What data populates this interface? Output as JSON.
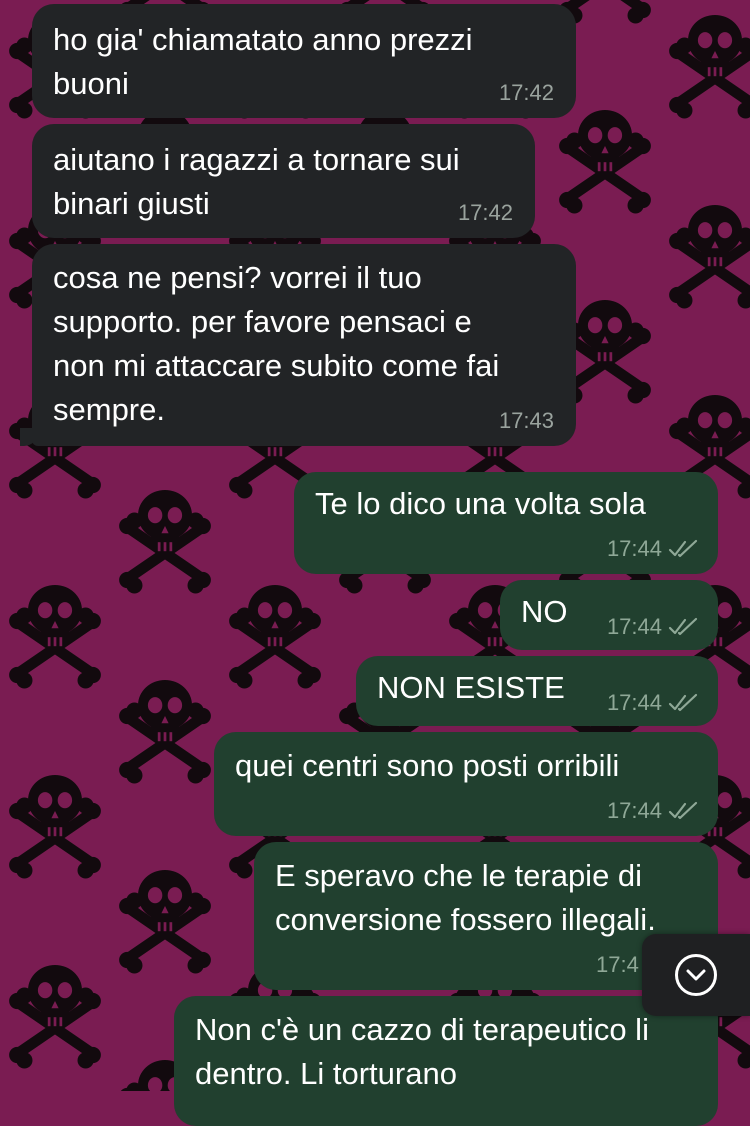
{
  "chat": {
    "messages": [
      {
        "direction": "in",
        "text": "ho gia' chiamatato anno prezzi\nbuoni",
        "time": "17:42"
      },
      {
        "direction": "in",
        "text": "aiutano i ragazzi a tornare sui\nbinari giusti",
        "time": "17:42"
      },
      {
        "direction": "in",
        "text": "cosa ne pensi? vorrei il tuo\nsupporto. per favore pensaci e\nnon mi attaccare subito come fai\nsempre.",
        "time": "17:43"
      },
      {
        "direction": "out",
        "text": "Te lo dico una volta sola",
        "time": "17:44",
        "status": "read"
      },
      {
        "direction": "out",
        "text": "NO",
        "time": "17:44",
        "status": "read"
      },
      {
        "direction": "out",
        "text": "NON ESISTE",
        "time": "17:44",
        "status": "read"
      },
      {
        "direction": "out",
        "text": "quei centri sono posti orribili",
        "time": "17:44",
        "status": "read"
      },
      {
        "direction": "out",
        "text": "E speravo che le terapie di\nconversione fossero illegali.",
        "time": "17:4",
        "status": "read"
      },
      {
        "direction": "out",
        "text": "Non c'è un cazzo di terapeutico li\ndentro. Li torturano",
        "time": "",
        "status": ""
      }
    ]
  },
  "wallpaper": {
    "icon": "skull-crossbones-icon",
    "background": "#7a1c52",
    "pattern_color": "#120a0e"
  },
  "colors": {
    "incoming_bubble": "#222426",
    "outgoing_bubble": "#21402f",
    "text": "#ffffff",
    "meta": "#9aa39e"
  },
  "scroll_down_button": {
    "icon": "chevron-down-icon"
  }
}
